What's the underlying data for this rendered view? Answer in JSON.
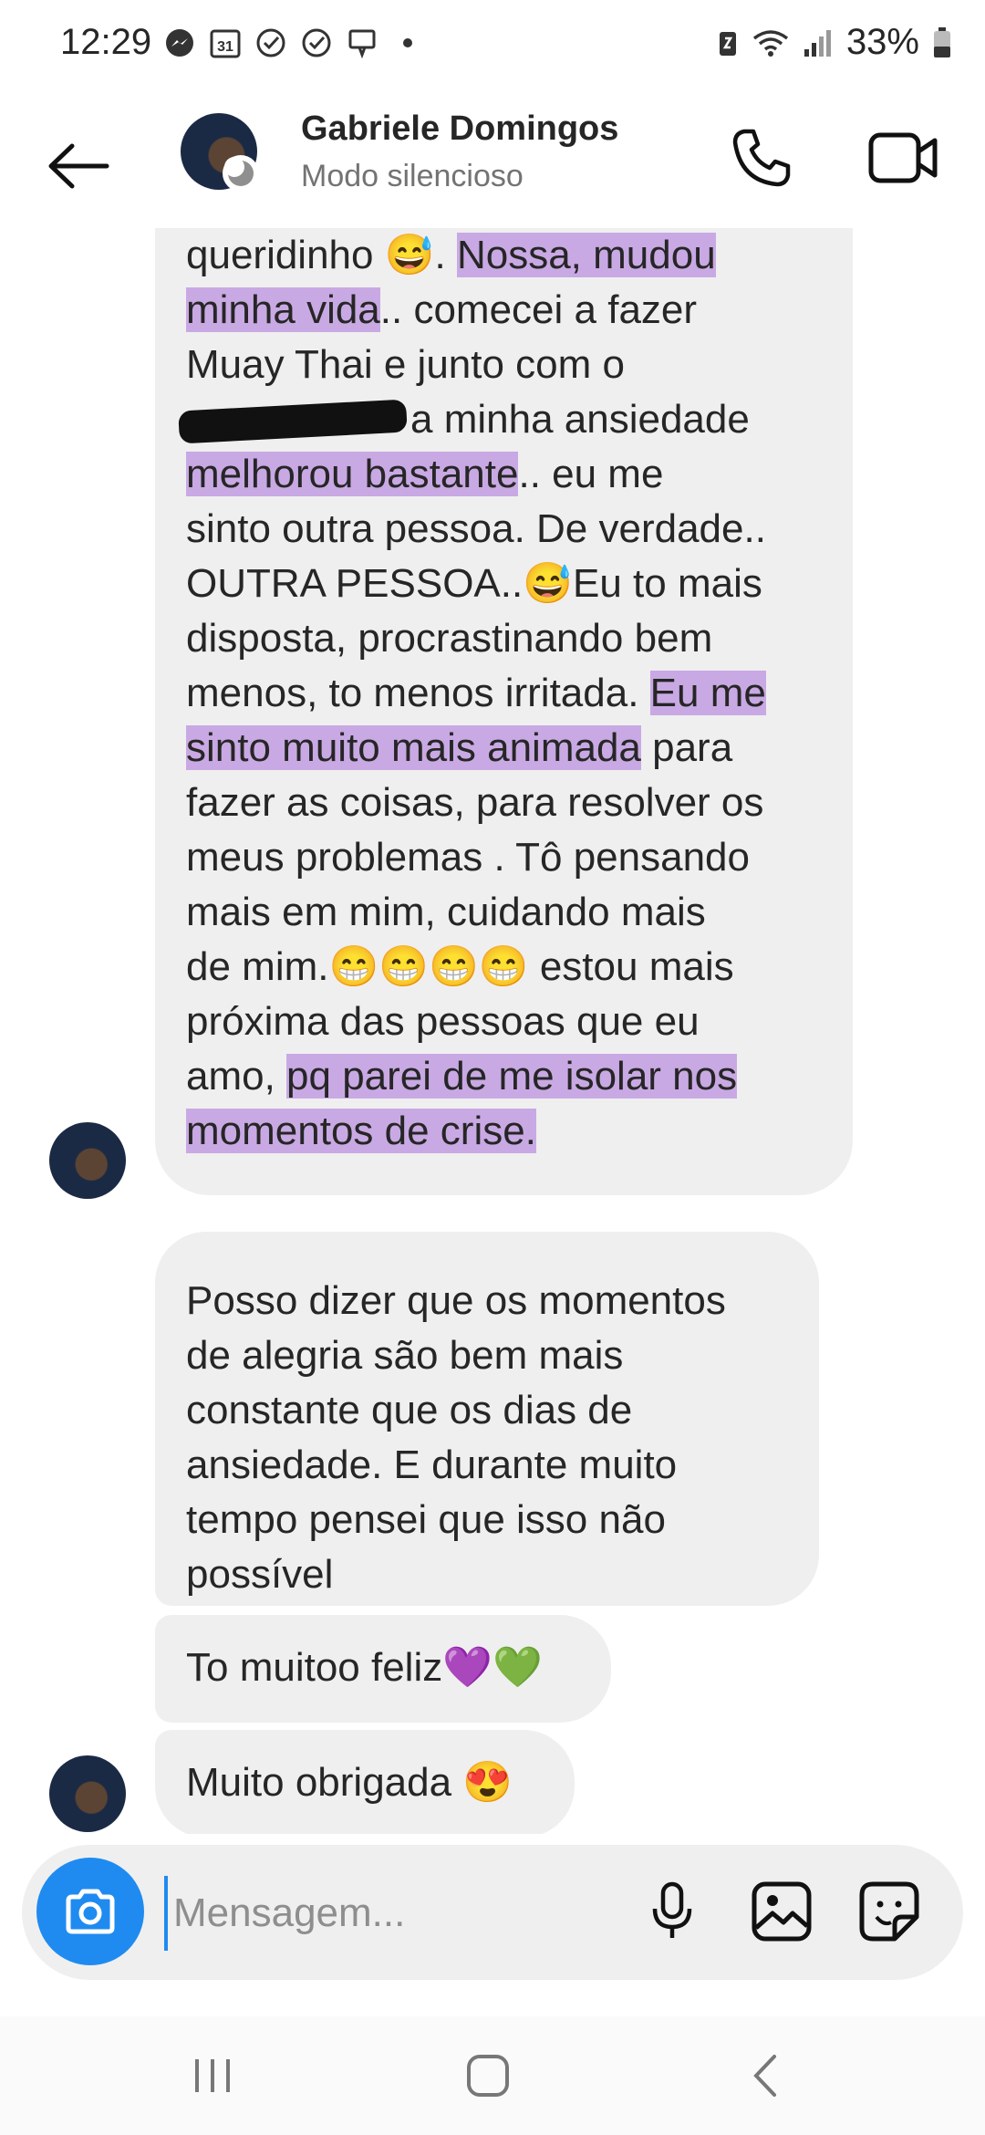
{
  "status_bar": {
    "time": "12:29",
    "calendar_day": "31",
    "battery": "33%"
  },
  "header": {
    "name": "Gabriele Domingos",
    "subtitle": "Modo silencioso"
  },
  "messages": [
    {
      "lines": [
        [
          "queridinho 😅. ",
          {
            "hl": "Nossa, mudou"
          }
        ],
        [
          {
            "hl": "minha vida"
          },
          ".. comecei a fazer"
        ],
        [
          "Muay Thai e junto com o"
        ],
        [
          {
            "redact": true
          },
          "a minha ansiedade"
        ],
        [
          {
            "hl": "melhorou bastante"
          },
          ".. eu me"
        ],
        [
          "sinto outra pessoa. De verdade.."
        ],
        [
          "OUTRA PESSOA..😅Eu to mais"
        ],
        [
          "disposta, procrastinando bem"
        ],
        [
          "menos, to menos irritada. ",
          {
            "hl": "Eu me"
          }
        ],
        [
          {
            "hl": "sinto muito mais animada"
          },
          " para"
        ],
        [
          "fazer as coisas, para resolver os"
        ],
        [
          "meus problemas . Tô pensando"
        ],
        [
          "mais em mim, cuidando mais"
        ],
        [
          "de mim.😁😁😁😁 estou mais"
        ],
        [
          "próxima das pessoas que eu"
        ],
        [
          "amo, ",
          {
            "hl": "pq parei de me isolar nos"
          }
        ],
        [
          {
            "hl": "momentos de crise."
          }
        ]
      ]
    },
    {
      "lines": [
        [
          "Posso dizer que os momentos"
        ],
        [
          "de alegria são bem mais"
        ],
        [
          "constante que os dias de"
        ],
        [
          "ansiedade. E durante muito"
        ],
        [
          "tempo pensei que isso não"
        ],
        [
          "possível"
        ]
      ]
    },
    {
      "lines": [
        [
          "To muitoo feliz💜💚"
        ]
      ]
    },
    {
      "lines": [
        [
          "Muito obrigada 😍"
        ]
      ]
    }
  ],
  "composer": {
    "placeholder": "Mensagem..."
  },
  "icons": {
    "back": "arrow-left-icon",
    "call": "phone-icon",
    "video": "video-camera-icon",
    "camera": "camera-icon",
    "mic": "microphone-icon",
    "gallery": "image-icon",
    "sticker": "sticker-icon",
    "nav_recent": "recent-apps-icon",
    "nav_home": "home-icon",
    "nav_back": "chevron-left-icon"
  },
  "colors": {
    "accent": "#1f8bf0",
    "highlight": "#c9a9e4",
    "bubble": "#efefef"
  }
}
